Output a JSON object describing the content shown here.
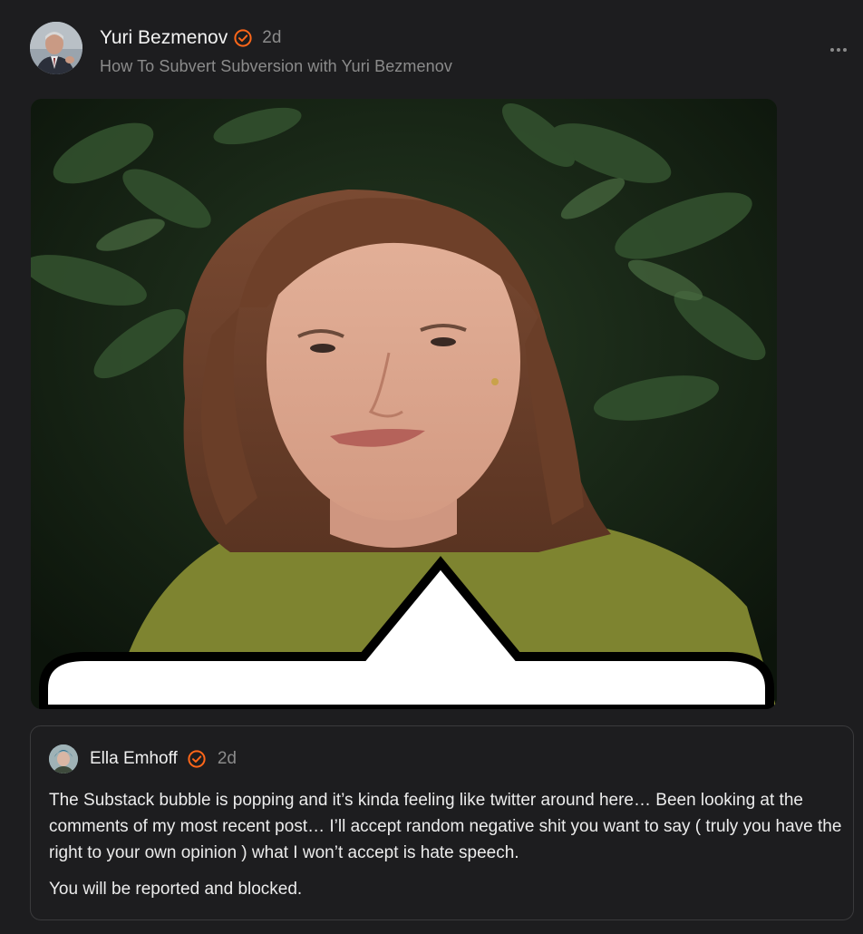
{
  "post": {
    "author_name": "Yuri Bezmenov",
    "timestamp": "2d",
    "publication": "How To Subvert Subversion with Yuri Bezmenov",
    "verified_color": "#ff6719",
    "more_icon": "more-horizontal-icon"
  },
  "quote": {
    "author_name": "Ella Emhoff",
    "timestamp": "2d",
    "body_1": "The Substack bubble is popping and it’s kinda feeling like twitter around here… Been looking at the comments of my most recent post… I’ll accept random negative shit you want to say ( truly you have the right to your own opinion ) what I won’t accept is hate speech.",
    "body_2": "You will be reported and blocked."
  }
}
